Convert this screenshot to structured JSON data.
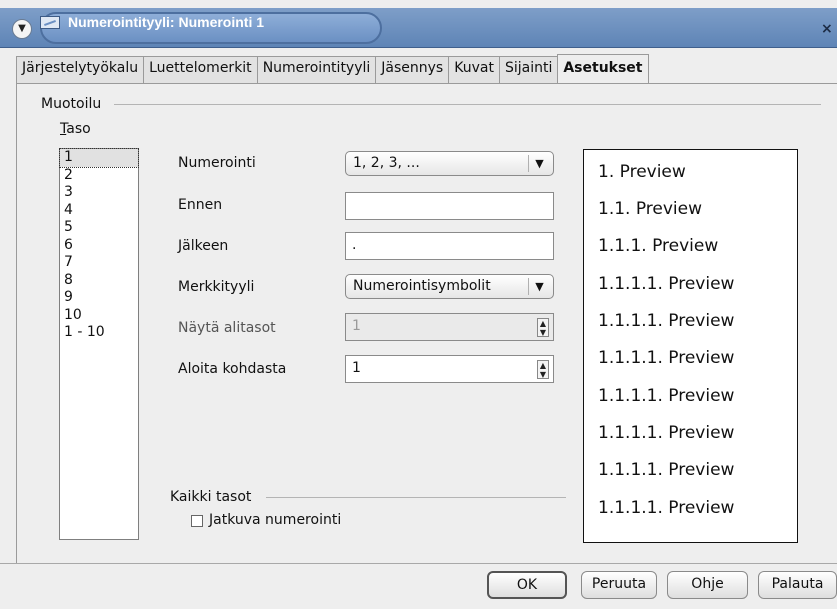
{
  "window": {
    "title": "Numerointityyli: Numerointi 1",
    "close_glyph": "×"
  },
  "tabs": [
    {
      "label": "Järjestelytyökalu"
    },
    {
      "label": "Luettelomerkit"
    },
    {
      "label": "Numerointityyli"
    },
    {
      "label": "Jäsennys"
    },
    {
      "label": "Kuvat"
    },
    {
      "label": "Sijainti"
    },
    {
      "label": "Asetukset",
      "active": true
    }
  ],
  "format": {
    "section_title": "Muotoilu",
    "level_title": "Taso",
    "levels": [
      "1",
      "2",
      "3",
      "4",
      "5",
      "6",
      "7",
      "8",
      "9",
      "10",
      "1 - 10"
    ],
    "selected_level": "1",
    "numbering_label": "Numerointi",
    "numbering_value": "1, 2, 3, ...",
    "before_label": "Ennen",
    "before_value": "",
    "after_label": "Jälkeen",
    "after_value": ".",
    "char_style_label": "Merkkityyli",
    "char_style_value": "Numerointisymbolit",
    "show_sublevels_label": "Näytä alitasot",
    "show_sublevels_value": "1",
    "start_at_label": "Aloita kohdasta",
    "start_at_value": "1"
  },
  "all_levels": {
    "section_title": "Kaikki tasot",
    "continuous_label": "Jatkuva numerointi",
    "continuous_checked": false
  },
  "preview": [
    "1. Preview",
    "1.1. Preview",
    "1.1.1. Preview",
    "1.1.1.1. Preview",
    "1.1.1.1. Preview",
    "1.1.1.1. Preview",
    "1.1.1.1. Preview",
    "1.1.1.1. Preview",
    "1.1.1.1. Preview",
    "1.1.1.1. Preview"
  ],
  "buttons": {
    "ok": "OK",
    "cancel": "Peruuta",
    "help": "Ohje",
    "reset": "Palauta"
  },
  "icons": {
    "window_menu": "chevron-down-icon",
    "window_app": "numbering-style-icon",
    "close": "close-icon",
    "combo_arrow": "dropdown-arrow-icon",
    "spin": "spin-arrows-icon"
  },
  "colors": {
    "titlebar": "#6b90c3",
    "dialog_bg": "#eeeeee",
    "selected_level": "#e1e1e1"
  }
}
